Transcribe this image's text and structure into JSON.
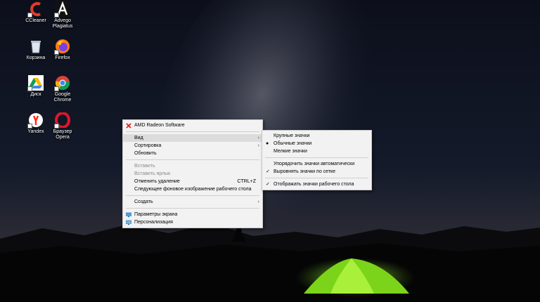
{
  "desktop": {
    "icons": [
      {
        "label": "CCleaner"
      },
      {
        "label": "Advego Plagiatus"
      },
      {
        "label": "Корзина"
      },
      {
        "label": "Firefox"
      },
      {
        "label": "Диск"
      },
      {
        "label": "Google Chrome"
      },
      {
        "label": "Yandex"
      },
      {
        "label": "Браузер Opera"
      }
    ]
  },
  "context_menu": {
    "header": "AMD Radeon Software",
    "items": [
      {
        "label": "Вид"
      },
      {
        "label": "Сортировка"
      },
      {
        "label": "Обновить"
      },
      {
        "label": "Вставить"
      },
      {
        "label": "Вставить ярлык"
      },
      {
        "label": "Отменить удаление",
        "shortcut": "CTRL+Z"
      },
      {
        "label": "Следующее фоновое изображение рабочего стола"
      },
      {
        "label": "Создать"
      },
      {
        "label": "Параметры экрана"
      },
      {
        "label": "Персонализация"
      }
    ]
  },
  "view_submenu": {
    "items": [
      {
        "label": "Крупные значки"
      },
      {
        "label": "Обычные значки"
      },
      {
        "label": "Мелкие значки"
      },
      {
        "label": "Упорядочить значки автоматически"
      },
      {
        "label": "Выровнять значки по сетке"
      },
      {
        "label": "Отображать значки рабочего стола"
      }
    ]
  },
  "colors": {
    "menu_bg": "#f2f2f2",
    "hover": "#dcdcdc",
    "amd_red": "#e2231a"
  }
}
